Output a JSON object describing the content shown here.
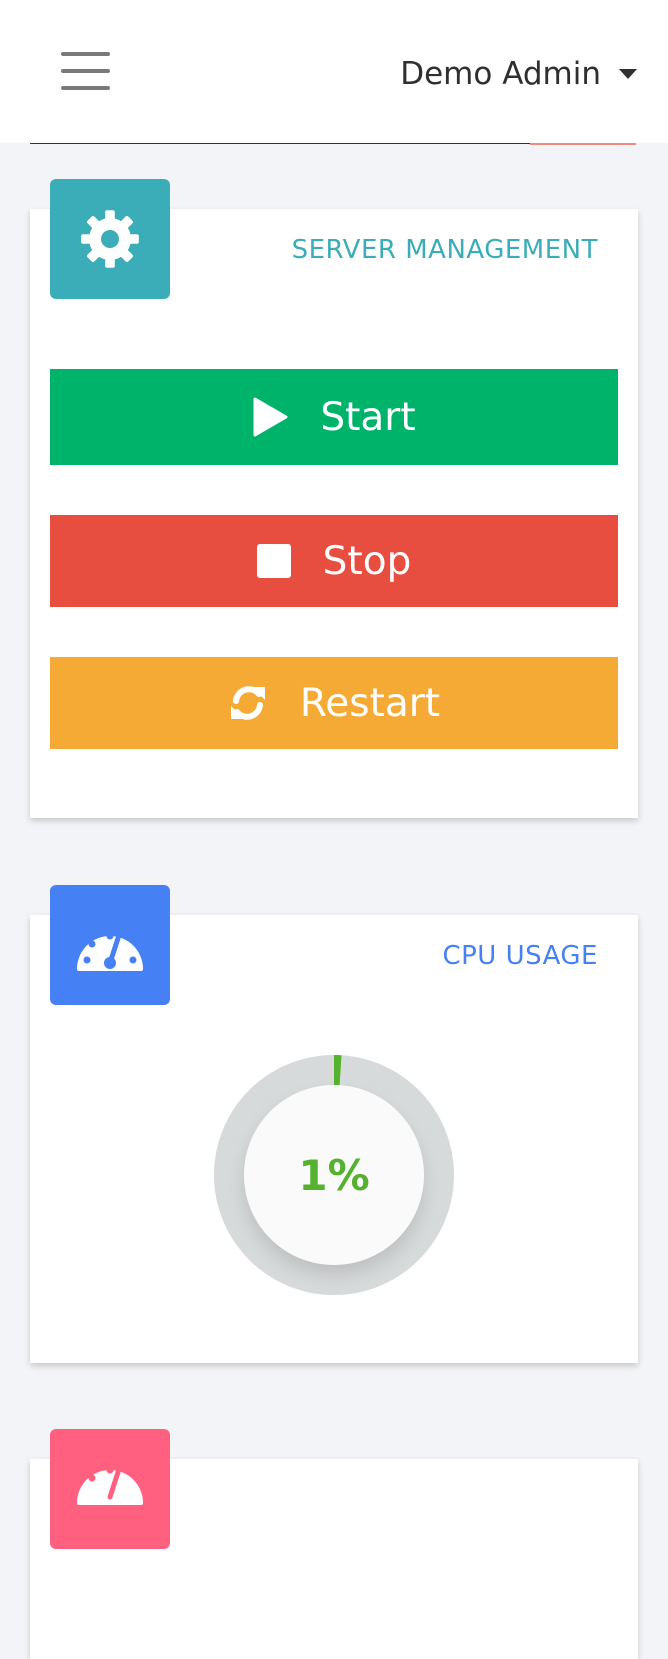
{
  "header": {
    "user_name": "Demo Admin"
  },
  "server_card": {
    "title": "SERVER MANAGEMENT",
    "icon": "gear-icon",
    "accent": "#3badb8",
    "buttons": [
      {
        "label": "Start",
        "icon": "play-icon",
        "color": "#00b36b"
      },
      {
        "label": "Stop",
        "icon": "stop-icon",
        "color": "#e84e40"
      },
      {
        "label": "Restart",
        "icon": "sync-icon",
        "color": "#f4aa35"
      }
    ]
  },
  "cpu_card": {
    "title": "CPU USAGE",
    "icon": "gauge-icon",
    "accent": "#4680f5",
    "value_label": "1%",
    "value_percent": 1,
    "value_color": "#55b22f"
  },
  "next_card": {
    "icon": "gauge-icon",
    "accent": "#ff6080"
  }
}
